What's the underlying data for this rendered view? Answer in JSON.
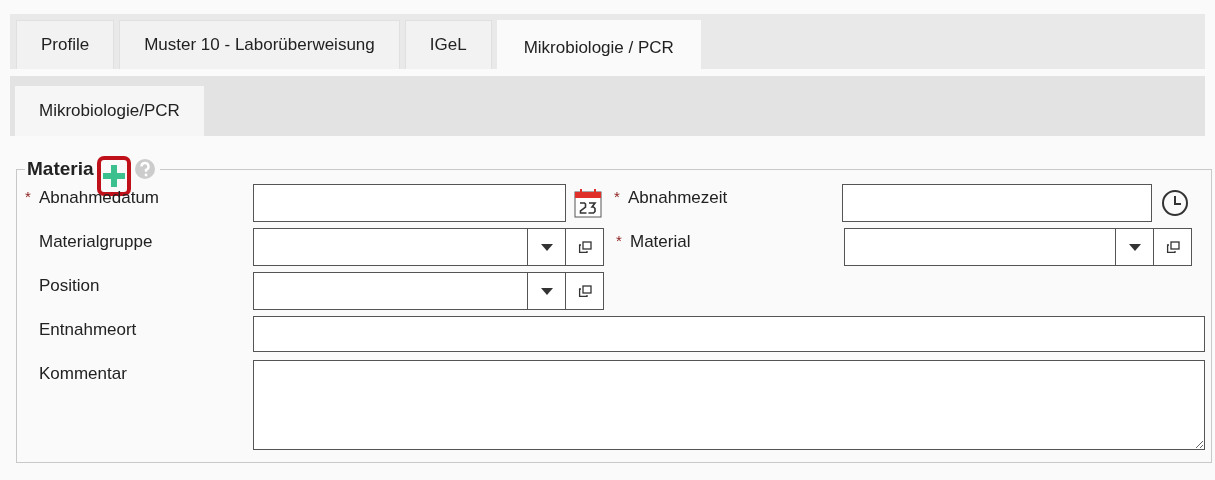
{
  "tabs": [
    {
      "label": "Profile",
      "selected": false
    },
    {
      "label": "Muster 10 - Laborüberweisung",
      "selected": false
    },
    {
      "label": "IGeL",
      "selected": false
    },
    {
      "label": "Mikrobiologie / PCR",
      "selected": true
    }
  ],
  "subtabs": [
    {
      "label": "Mikrobiologie/PCR",
      "selected": true
    }
  ],
  "section": {
    "title": "Materia",
    "add_highlighted": true
  },
  "rows": [
    [
      {
        "kind": "date",
        "label": "Abnahmedatum",
        "required_mark": "*"
      },
      {
        "kind": "time",
        "label": "Abnahmezeit",
        "required_mark": "*"
      }
    ],
    [
      {
        "kind": "select",
        "label": "Materialgruppe"
      },
      {
        "kind": "select",
        "label": "Material",
        "required_mark": "*"
      }
    ],
    [
      {
        "kind": "select",
        "label": "Position"
      }
    ],
    [
      {
        "kind": "text",
        "label": "Entnahmeort"
      }
    ],
    [
      {
        "kind": "textarea",
        "label": "Kommentar"
      }
    ]
  ]
}
